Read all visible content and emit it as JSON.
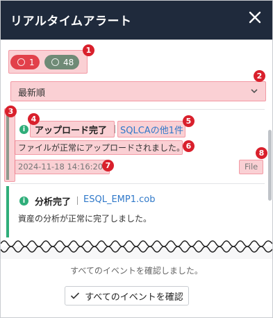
{
  "header": {
    "title": "リアルタイムアラート",
    "close_icon": "close-icon"
  },
  "counts": {
    "error": "1",
    "success": "48",
    "error_color": "#e2404a",
    "success_color": "#6f8a76"
  },
  "sort": {
    "selected": "最新順"
  },
  "markers": [
    "1",
    "2",
    "3",
    "4",
    "5",
    "6",
    "7",
    "8"
  ],
  "events": [
    {
      "title": "アップロード完了",
      "target": "SQLCAの他1件",
      "message": "ファイルが正常にアップロードされました。",
      "timestamp": "2024-11-18 14:16:20",
      "action": "File",
      "accent": "#8d9a8d"
    },
    {
      "title": "分析完了",
      "target": "ESQL_EMP1.cob",
      "message": "資産の分析が正常に完了しました。",
      "accent": "#2fae7a"
    }
  ],
  "footer": {
    "status": "すべてのイベントを確認しました。",
    "confirm_label": "すべてのイベントを確認"
  }
}
